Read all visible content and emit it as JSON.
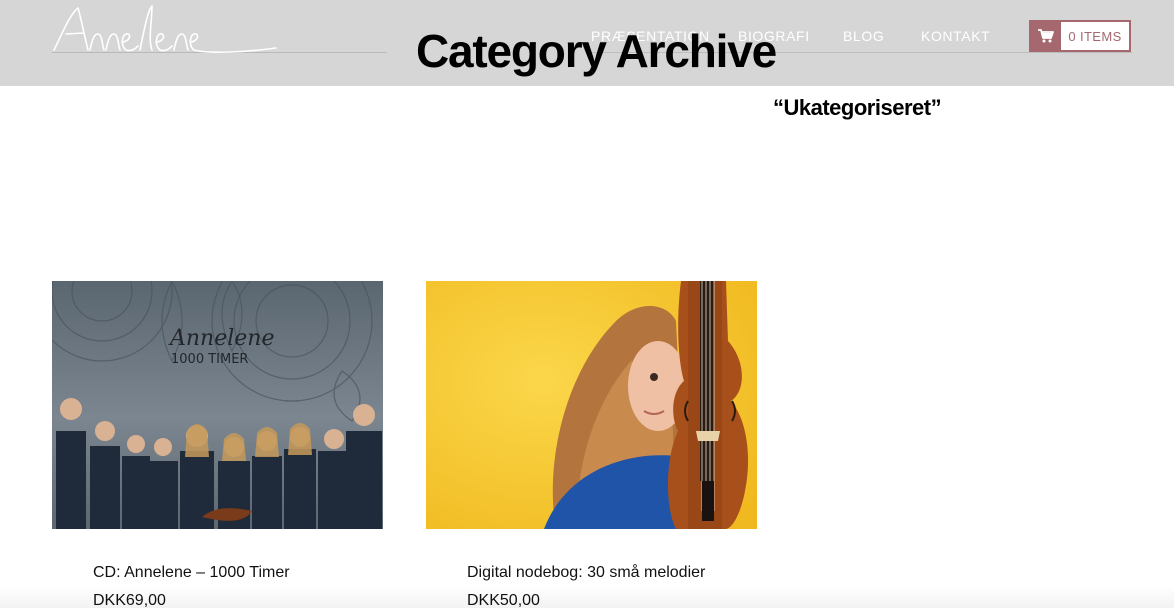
{
  "site": {
    "logo_text": "Annelene"
  },
  "nav": {
    "items": [
      {
        "label": "PRÆSENTATION"
      },
      {
        "label": "BIOGRAFI"
      },
      {
        "label": "BLOG"
      },
      {
        "label": "KONTAKT"
      }
    ]
  },
  "cart": {
    "label": "0 ITEMS",
    "icon": "cart-icon"
  },
  "archive": {
    "title": "Category Archive",
    "category": "“Ukategoriseret”"
  },
  "products": [
    {
      "name": "CD: Annelene – 1000 Timer",
      "price": "DKK69,00",
      "cover_artist": "Annelene",
      "cover_title": "1000 TIMER"
    },
    {
      "name": "Digital nodebog: 30 små melodier",
      "price": "DKK50,00"
    }
  ],
  "colors": {
    "header_bg": "#d6d6d6",
    "accent": "#a5686e",
    "yellow_bg": "#f3c62e"
  }
}
